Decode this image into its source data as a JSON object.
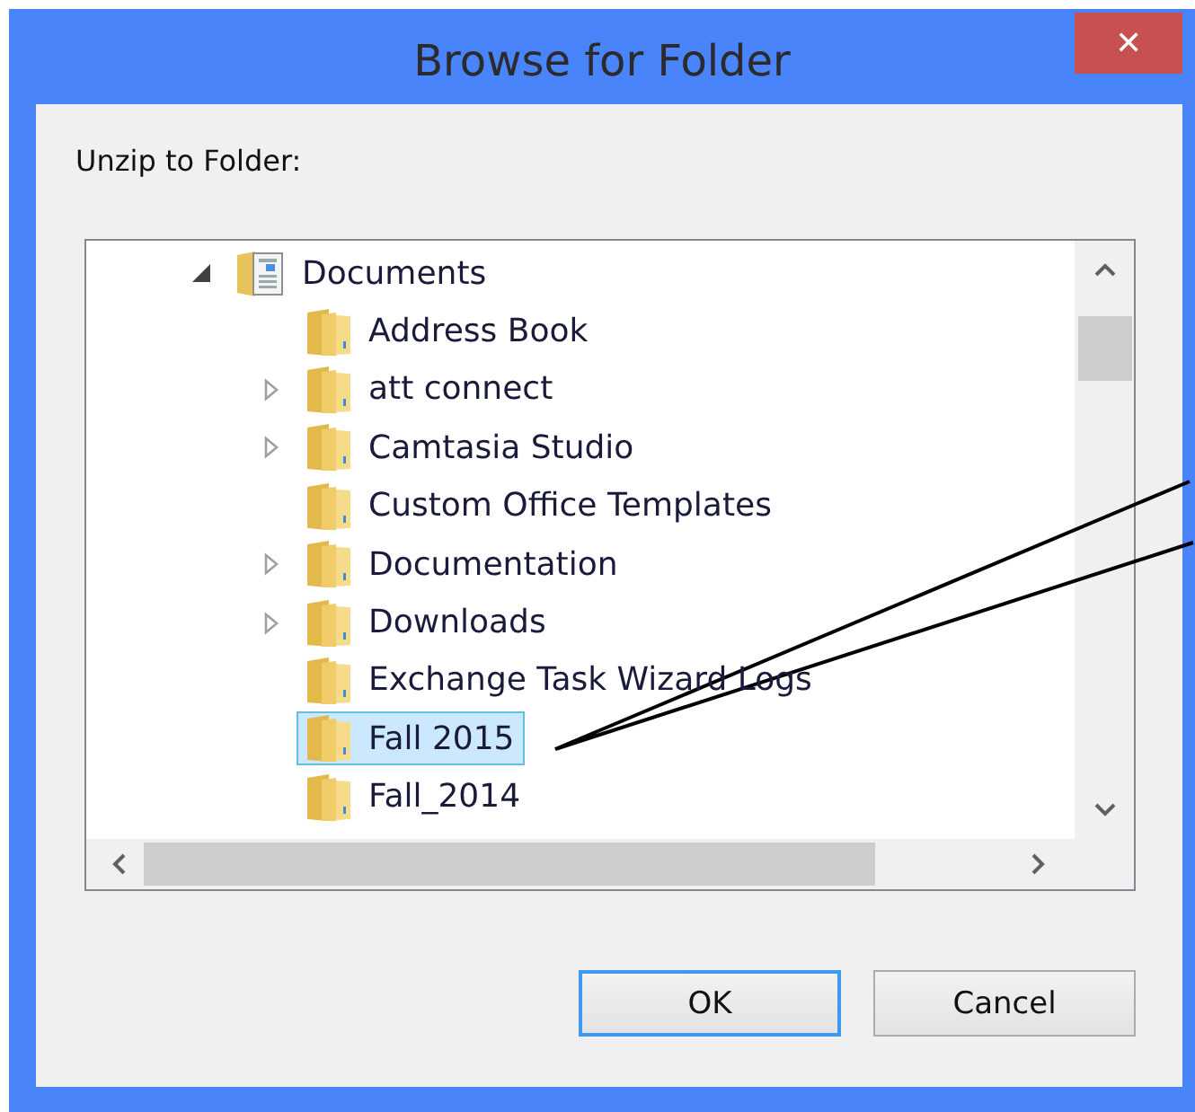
{
  "window": {
    "title": "Browse for Folder",
    "close": "✕"
  },
  "prompt": "Unzip to Folder:",
  "tree": [
    {
      "label": "Documents",
      "expandable": true,
      "expanded": true,
      "selected": false,
      "children": [
        {
          "label": "Address Book",
          "expandable": false,
          "selected": false
        },
        {
          "label": "att connect",
          "expandable": true,
          "expanded": false,
          "selected": false
        },
        {
          "label": "Camtasia Studio",
          "expandable": true,
          "expanded": false,
          "selected": false
        },
        {
          "label": "Custom Office Templates",
          "expandable": false,
          "selected": false
        },
        {
          "label": "Documentation",
          "expandable": true,
          "expanded": false,
          "selected": false
        },
        {
          "label": "Downloads",
          "expandable": true,
          "expanded": false,
          "selected": false
        },
        {
          "label": "Exchange Task Wizard Logs",
          "expandable": false,
          "selected": false
        },
        {
          "label": "Fall 2015",
          "expandable": false,
          "selected": true
        },
        {
          "label": "Fall_2014",
          "expandable": false,
          "selected": false
        }
      ]
    }
  ],
  "buttons": [
    {
      "label": "OK",
      "default": true
    },
    {
      "label": "Cancel",
      "default": false
    }
  ]
}
